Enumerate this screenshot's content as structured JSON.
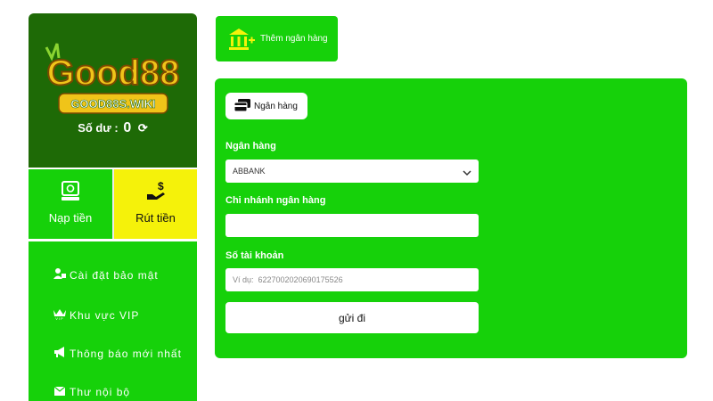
{
  "brand": {
    "logo_text": "Good88",
    "logo_sub": "GOOD88S.WIKI"
  },
  "balance": {
    "label": "Số dư :",
    "amount": "0"
  },
  "actions": {
    "deposit_label": "Nạp tiền",
    "withdraw_label": "Rút tiền"
  },
  "menu": {
    "items": [
      {
        "label": "Cài đặt bảo mật",
        "icon": "user-lock-icon"
      },
      {
        "label": "Khu vực VIP",
        "icon": "crown-vip-icon"
      },
      {
        "label": "Thông báo mới nhất",
        "icon": "megaphone-icon"
      },
      {
        "label": "Thư nội bộ",
        "icon": "envelope-icon"
      }
    ]
  },
  "add_bank": {
    "label": "Thêm ngân hàng"
  },
  "form": {
    "tab_label": "Ngân hàng",
    "bank_label": "Ngân hàng",
    "bank_value": "ABBANK",
    "branch_label": "Chi nhánh ngân hàng",
    "branch_value": "",
    "account_label": "Số tài khoản",
    "account_placeholder": "Ví dụ:  6227002020690175526",
    "submit_label": "gửi đi"
  },
  "colors": {
    "primary_green": "#16d10a",
    "dark_green": "#1e6a06",
    "yellow": "#f5f20a",
    "logo_gold": "#f0c419"
  }
}
